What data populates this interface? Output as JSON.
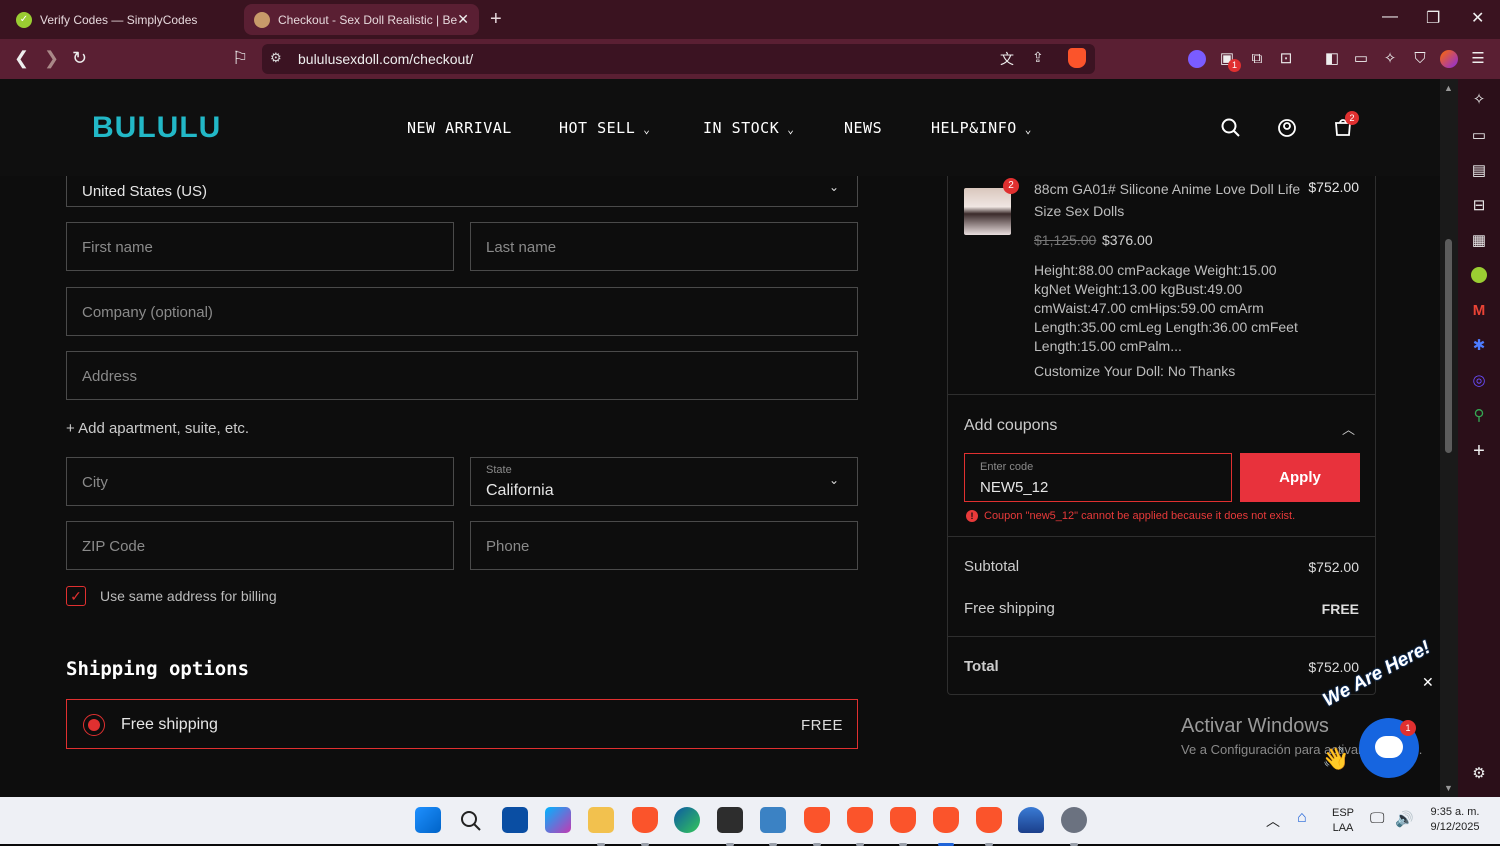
{
  "browser": {
    "tabs": [
      {
        "title": "Verify Codes — SimplyCodes",
        "active": false
      },
      {
        "title": "Checkout - Sex Doll Realistic | Be",
        "active": true
      }
    ],
    "url": "bululusexdoll.com/checkout/",
    "extension_badge": "1"
  },
  "site": {
    "logo": "BULULU",
    "nav": [
      {
        "label": "NEW ARRIVAL",
        "has_dropdown": false
      },
      {
        "label": "HOT SELL",
        "has_dropdown": true
      },
      {
        "label": "IN STOCK",
        "has_dropdown": true
      },
      {
        "label": "NEWS",
        "has_dropdown": false
      },
      {
        "label": "HELP&INFO",
        "has_dropdown": true
      }
    ],
    "cart_count": "2"
  },
  "form": {
    "country": "United States (US)",
    "first_name_placeholder": "First name",
    "last_name_placeholder": "Last name",
    "company_placeholder": "Company (optional)",
    "address_placeholder": "Address",
    "add_apartment": "+ Add apartment, suite, etc.",
    "city_placeholder": "City",
    "state_label": "State",
    "state_value": "California",
    "zip_placeholder": "ZIP Code",
    "phone_placeholder": "Phone",
    "billing_same_label": "Use same address for billing",
    "billing_same_checked": true
  },
  "shipping": {
    "heading": "Shipping options",
    "option_name": "Free shipping",
    "option_price": "FREE",
    "selected": true
  },
  "summary": {
    "item": {
      "qty": "2",
      "name": "88cm GA01# Silicone Anime Love Doll Life Size Sex Dolls",
      "line_total": "$752.00",
      "old_price": "$1,125.00",
      "price": "$376.00",
      "description": "Height:88.00 cmPackage Weight:15.00 kgNet Weight:13.00 kgBust:49.00 cmWaist:47.00 cmHips:59.00 cmArm Length:35.00 cmLeg Length:36.00 cmFeet Length:15.00 cmPalm...",
      "customize": "Customize Your Doll: No Thanks"
    },
    "coupon": {
      "heading": "Add coupons",
      "input_label": "Enter code",
      "input_value": "NEW5_12",
      "apply_label": "Apply",
      "error": "Coupon \"new5_12\" cannot be applied because it does not exist."
    },
    "subtotal_label": "Subtotal",
    "subtotal_value": "$752.00",
    "shipping_label": "Free shipping",
    "shipping_value": "FREE",
    "total_label": "Total",
    "total_value": "$752.00"
  },
  "watermark": {
    "title": "Activar Windows",
    "subtitle": "Ve a Configuración para activar Windows."
  },
  "chat": {
    "tagline": "We Are Here!",
    "badge": "1"
  },
  "taskbar": {
    "lang_top": "ESP",
    "lang_bottom": "LAA",
    "time": "9:35 a. m.",
    "date": "9/12/2025"
  },
  "colors": {
    "accent_red": "#e8323c",
    "logo_teal": "#22b8c7",
    "browser_frame": "#5a1f33"
  }
}
